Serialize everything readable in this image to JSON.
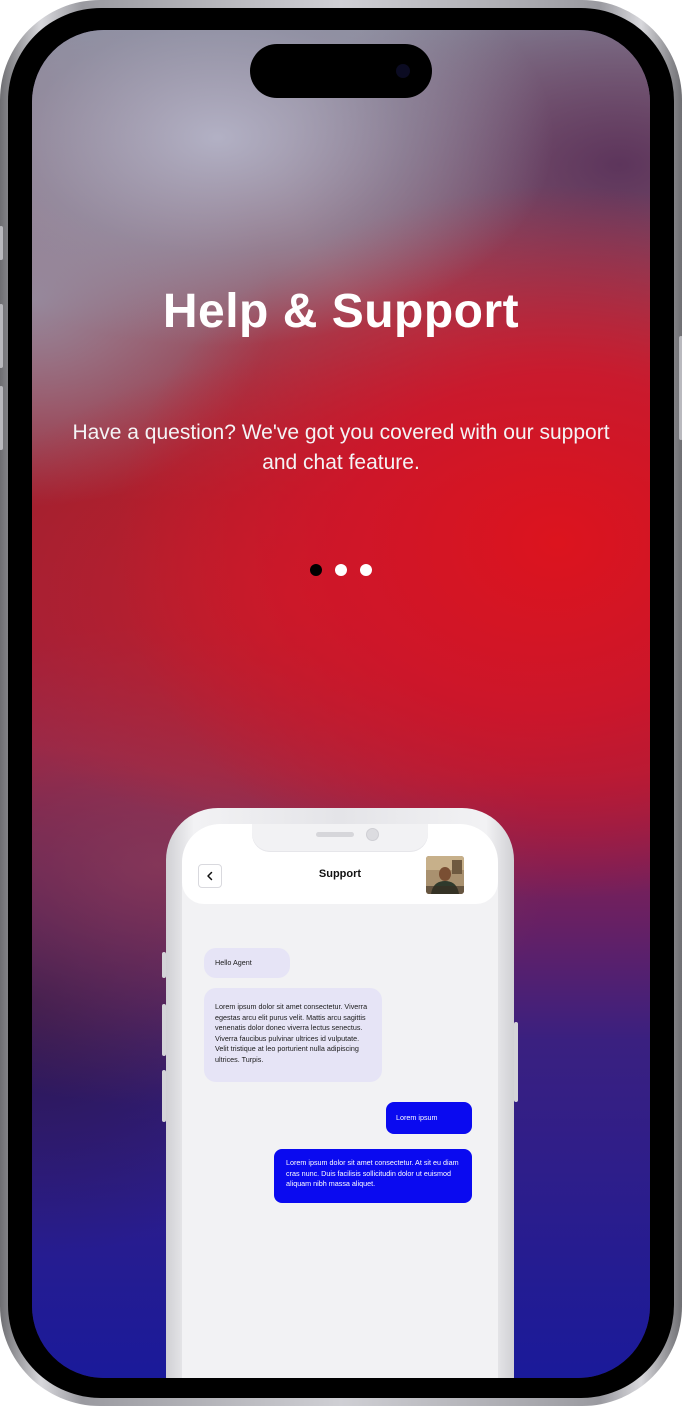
{
  "onboarding": {
    "title": "Help & Support",
    "subtitle": "Have a question? We've got you covered with our support and chat feature.",
    "pagination": {
      "total": 3,
      "active_index": 0
    }
  },
  "chat": {
    "header_title": "Support",
    "back_icon": "chevron-left-icon",
    "messages": [
      {
        "direction": "incoming",
        "text": "Hello Agent"
      },
      {
        "direction": "incoming",
        "text": "Lorem ipsum dolor sit amet consectetur. Viverra egestas arcu elit purus velit. Mattis arcu sagittis venenatis dolor donec viverra lectus senectus. Viverra faucibus pulvinar ultrices id vulputate. Velit tristique at leo porturient nulla adipiscing ultrices. Turpis."
      },
      {
        "direction": "outgoing",
        "text": "Lorem ipsum"
      },
      {
        "direction": "outgoing",
        "text": "Lorem ipsum dolor sit amet consectetur. At sit eu diam cras nunc. Duis facilisis sollicitudin dolor ut euismod aliquam nibh massa aliquet."
      }
    ]
  },
  "colors": {
    "accent_outgoing": "#0a0af0",
    "incoming_bubble": "#e6e4f6",
    "dot_active": "#000000",
    "dot_inactive": "#ffffff"
  }
}
